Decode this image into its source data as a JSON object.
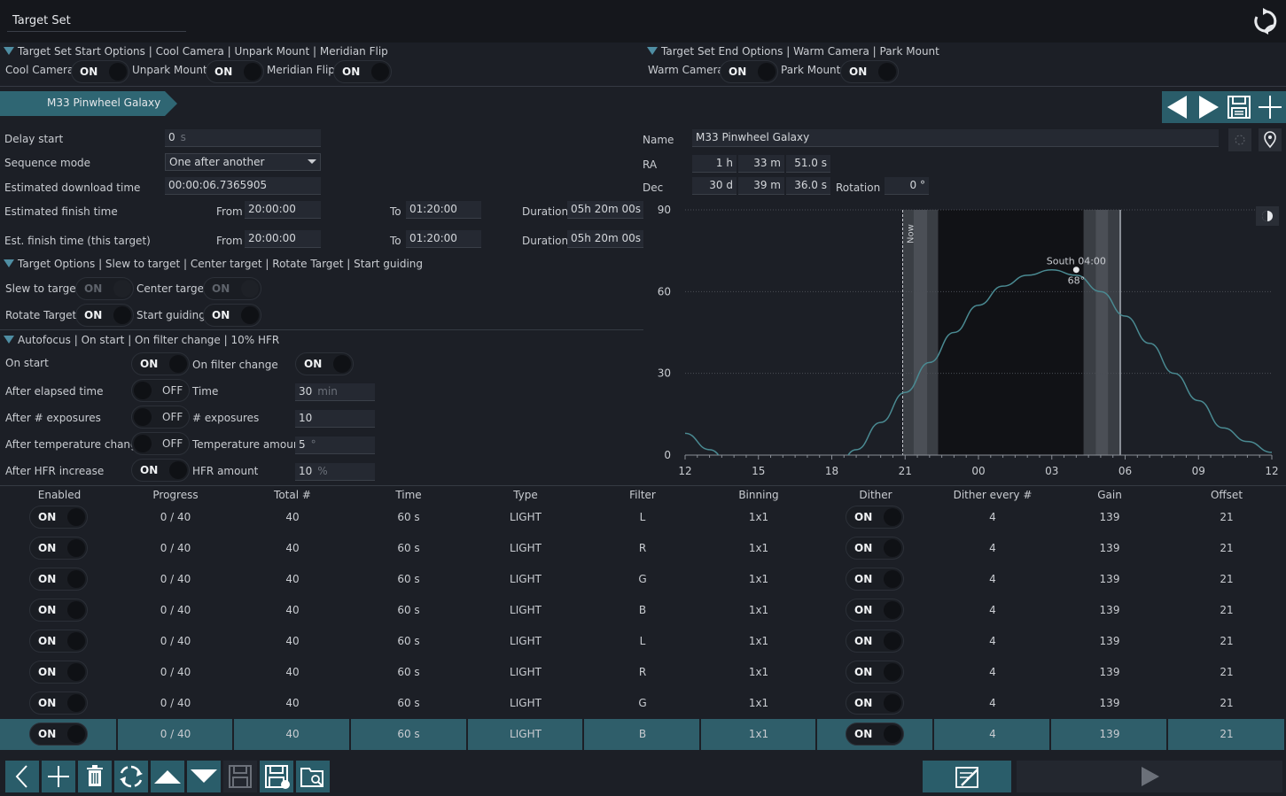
{
  "title": "Target Set",
  "start_options": {
    "header": "Target Set Start Options",
    "header_rest": " | Cool Camera | Unpark Mount | Meridian Flip",
    "cool_label": "Cool Camera",
    "cool": "ON",
    "unpark_label": "Unpark Mount",
    "unpark": "ON",
    "meridian_label": "Meridian Flip",
    "meridian": "ON"
  },
  "end_options": {
    "header": "Target Set End Options",
    "header_rest": " | Warm Camera | Park Mount",
    "warm_label": "Warm Camera",
    "warm": "ON",
    "park_label": "Park Mount",
    "park": "ON"
  },
  "target_tab": "M33 Pinwheel Galaxy",
  "left": {
    "delay_label": "Delay start",
    "delay_value": "0",
    "delay_unit": "s",
    "seq_label": "Sequence mode",
    "seq_value": "One after another",
    "dl_label": "Estimated download time",
    "dl_value": "00:00:06.7365905",
    "eft_label": "Estimated finish time",
    "eft_from_label": "From",
    "eft_from": "20:00:00",
    "eft_to_label": "To",
    "eft_to": "01:20:00",
    "eft_dur_label": "Duration",
    "eft_dur": "05h 20m 00s",
    "eftt_label": "Est. finish time (this target)",
    "eftt_from_label": "From",
    "eftt_from": "20:00:00",
    "eftt_to_label": "To",
    "eftt_to": "01:20:00",
    "eftt_dur_label": "Duration",
    "eftt_dur": "05h 20m 00s"
  },
  "target_options": {
    "header": "Target Options",
    "header_rest": " | Slew to target | Center target | Rotate Target | Start guiding",
    "slew_label": "Slew to target",
    "slew": "ON",
    "center_label": "Center target",
    "center": "ON",
    "rotate_label": "Rotate Target",
    "rotate": "ON",
    "guide_label": "Start guiding",
    "guide": "ON"
  },
  "autofocus": {
    "header": "Autofocus",
    "header_rest": " | On start | On filter change | 10% HFR",
    "onstart_label": "On start",
    "onstart": "ON",
    "filter_label": "On filter change",
    "filter": "ON",
    "elapsed_label": "After elapsed time",
    "elapsed": "OFF",
    "time_label": "Time",
    "time_value": "30",
    "time_unit": "min",
    "exp_label": "After # exposures",
    "exp": "OFF",
    "nexp_label": "# exposures",
    "nexp_value": "10",
    "temp_label": "After temperature change",
    "temp": "OFF",
    "tempamt_label": "Temperature amount",
    "tempamt_value": "5",
    "tempamt_unit": "°",
    "hfr_label": "After HFR increase",
    "hfr": "ON",
    "hframt_label": "HFR amount",
    "hframt_value": "10",
    "hframt_unit": "%"
  },
  "coords": {
    "name_label": "Name",
    "name_value": "M33 Pinwheel Galaxy",
    "ra_label": "RA",
    "ra_h": "1",
    "ra_h_unit": "h",
    "ra_m": "33",
    "ra_m_unit": "m",
    "ra_s": "51.0",
    "ra_s_unit": "s",
    "dec_label": "Dec",
    "dec_d": "30",
    "dec_d_unit": "d",
    "dec_m": "39",
    "dec_m_unit": "m",
    "dec_s": "36.0",
    "dec_s_unit": "s",
    "rot_label": "Rotation",
    "rot_value": "0",
    "rot_unit": "°"
  },
  "chart_data": {
    "type": "line",
    "x_ticks": [
      "12",
      "15",
      "18",
      "21",
      "00",
      "03",
      "06",
      "09",
      "12"
    ],
    "y_ticks": [
      "0",
      "30",
      "60",
      "90"
    ],
    "ylim": [
      0,
      90
    ],
    "now_label": "Now",
    "annotation": "South 04:00",
    "annotation2": "68°",
    "peak": {
      "x_hour": 28,
      "alt": 68
    },
    "series": [
      {
        "values_hours": [
          12,
          13,
          14,
          15,
          16,
          17,
          18,
          19,
          20,
          21,
          22,
          23,
          24,
          25,
          26,
          27,
          28,
          29,
          30,
          31,
          32,
          33,
          34,
          35,
          36
        ],
        "values_alt": [
          8,
          2,
          -6,
          -14,
          -18,
          -15,
          -8,
          2,
          12,
          23,
          34,
          45,
          55,
          62,
          66,
          68,
          66,
          60,
          51,
          41,
          30,
          20,
          10,
          5,
          1
        ]
      }
    ],
    "colors": {
      "line": "#4a8a92",
      "night": "#111216",
      "twilight": "#3a3e44"
    }
  },
  "table": {
    "headers": [
      "Enabled",
      "Progress",
      "Total #",
      "Time",
      "Type",
      "Filter",
      "Binning",
      "Dither",
      "Dither every #",
      "Gain",
      "Offset"
    ],
    "rows": [
      {
        "enabled": "ON",
        "progress": "0 / 40",
        "total": "40",
        "time": "60 s",
        "type": "LIGHT",
        "filter": "L",
        "binning": "1x1",
        "dither": "ON",
        "dither_every": "4",
        "gain": "139",
        "offset": "21"
      },
      {
        "enabled": "ON",
        "progress": "0 / 40",
        "total": "40",
        "time": "60 s",
        "type": "LIGHT",
        "filter": "R",
        "binning": "1x1",
        "dither": "ON",
        "dither_every": "4",
        "gain": "139",
        "offset": "21"
      },
      {
        "enabled": "ON",
        "progress": "0 / 40",
        "total": "40",
        "time": "60 s",
        "type": "LIGHT",
        "filter": "G",
        "binning": "1x1",
        "dither": "ON",
        "dither_every": "4",
        "gain": "139",
        "offset": "21"
      },
      {
        "enabled": "ON",
        "progress": "0 / 40",
        "total": "40",
        "time": "60 s",
        "type": "LIGHT",
        "filter": "B",
        "binning": "1x1",
        "dither": "ON",
        "dither_every": "4",
        "gain": "139",
        "offset": "21"
      },
      {
        "enabled": "ON",
        "progress": "0 / 40",
        "total": "40",
        "time": "60 s",
        "type": "LIGHT",
        "filter": "L",
        "binning": "1x1",
        "dither": "ON",
        "dither_every": "4",
        "gain": "139",
        "offset": "21"
      },
      {
        "enabled": "ON",
        "progress": "0 / 40",
        "total": "40",
        "time": "60 s",
        "type": "LIGHT",
        "filter": "R",
        "binning": "1x1",
        "dither": "ON",
        "dither_every": "4",
        "gain": "139",
        "offset": "21"
      },
      {
        "enabled": "ON",
        "progress": "0 / 40",
        "total": "40",
        "time": "60 s",
        "type": "LIGHT",
        "filter": "G",
        "binning": "1x1",
        "dither": "ON",
        "dither_every": "4",
        "gain": "139",
        "offset": "21"
      },
      {
        "enabled": "ON",
        "progress": "0 / 40",
        "total": "40",
        "time": "60 s",
        "type": "LIGHT",
        "filter": "B",
        "binning": "1x1",
        "dither": "ON",
        "dither_every": "4",
        "gain": "139",
        "offset": "21"
      }
    ]
  }
}
